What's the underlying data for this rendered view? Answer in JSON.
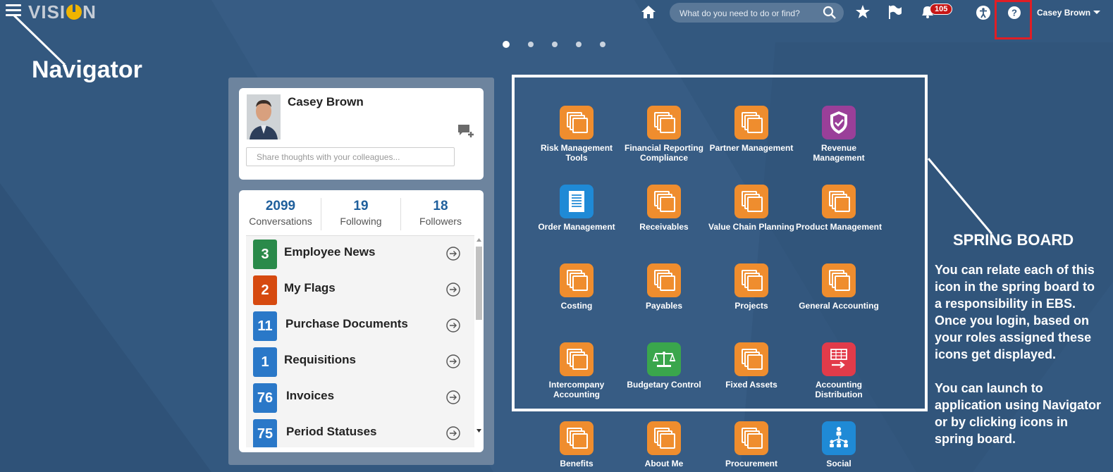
{
  "header": {
    "logo_left": "VISI",
    "logo_right": "N",
    "search_placeholder": "What do you need to do or find?",
    "notification_count": "105",
    "user_name": "Casey Brown",
    "icons": [
      "menu-icon",
      "home-icon",
      "search-icon",
      "star-icon",
      "flag-icon",
      "notification-icon",
      "accessibility-icon",
      "help-icon",
      "caret-down-icon"
    ]
  },
  "annotations": {
    "navigator": "Navigator",
    "spring_title": "SPRING BOARD",
    "spring_desc_1": "You can relate each of this icon in the spring board to a responsibility in EBS. Once you login, based on your roles assigned these icons get displayed.",
    "spring_desc_2": "You can launch to application using Navigator or by clicking icons in spring board.",
    "highlight_color": "#e01e25"
  },
  "pager": {
    "count": 5,
    "active": 0
  },
  "profile": {
    "name": "Casey Brown",
    "share_placeholder": "Share thoughts with your colleagues..."
  },
  "stats": [
    {
      "value": "2099",
      "label": "Conversations"
    },
    {
      "value": "19",
      "label": "Following"
    },
    {
      "value": "18",
      "label": "Followers"
    }
  ],
  "worklist": [
    {
      "count": "3",
      "label": "Employee News",
      "color": "#2a8a4a"
    },
    {
      "count": "2",
      "label": "My Flags",
      "color": "#d64a10"
    },
    {
      "count": "11",
      "label": "Purchase Documents",
      "color": "#2a78c8"
    },
    {
      "count": "1",
      "label": "Requisitions",
      "color": "#2a78c8"
    },
    {
      "count": "76",
      "label": "Invoices",
      "color": "#2a78c8"
    },
    {
      "count": "75",
      "label": "Period Statuses",
      "color": "#2a78c8"
    }
  ],
  "springboard": [
    {
      "label": "Risk Management Tools",
      "icon": "orange-stack-icon"
    },
    {
      "label": "Financial Reporting Compliance",
      "icon": "orange-stack-icon"
    },
    {
      "label": "Partner Management",
      "icon": "orange-stack-icon"
    },
    {
      "label": "Revenue Management",
      "icon": "shield-check-icon"
    },
    {
      "label": "Order Management",
      "icon": "document-icon"
    },
    {
      "label": "Receivables",
      "icon": "orange-stack-icon"
    },
    {
      "label": "Value Chain Planning",
      "icon": "orange-stack-icon"
    },
    {
      "label": "Product Management",
      "icon": "orange-stack-icon"
    },
    {
      "label": "Costing",
      "icon": "orange-stack-icon"
    },
    {
      "label": "Payables",
      "icon": "orange-stack-icon"
    },
    {
      "label": "Projects",
      "icon": "orange-stack-icon"
    },
    {
      "label": "General Accounting",
      "icon": "orange-stack-icon"
    },
    {
      "label": "Intercompany Accounting",
      "icon": "orange-stack-icon"
    },
    {
      "label": "Budgetary Control",
      "icon": "balance-scale-icon"
    },
    {
      "label": "Fixed Assets",
      "icon": "orange-stack-icon"
    },
    {
      "label": "Accounting Distribution",
      "icon": "distribution-table-icon"
    },
    {
      "label": "Benefits",
      "icon": "orange-stack-icon"
    },
    {
      "label": "About Me",
      "icon": "orange-stack-icon"
    },
    {
      "label": "Procurement",
      "icon": "orange-stack-icon"
    },
    {
      "label": "Social",
      "icon": "social-network-icon"
    }
  ]
}
